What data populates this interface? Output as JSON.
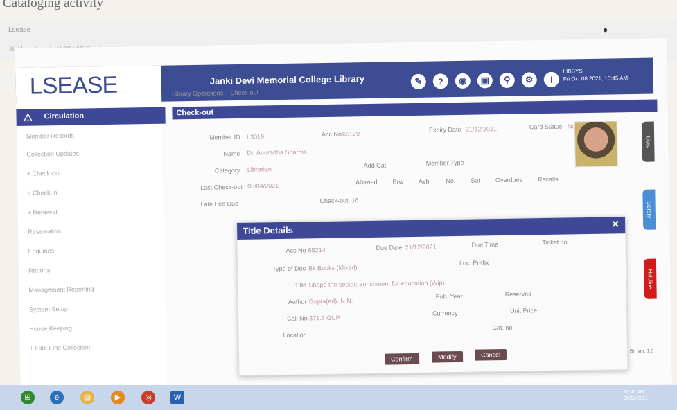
{
  "caption": "Cataloging activity",
  "browser": {
    "tab_label": "Lsease",
    "url": "lib.jdmc.du.ac.in / LSEASE/Circulation/Checkout"
  },
  "app": {
    "logo": "LSEASE",
    "title": "Janki Devi Memorial College Library",
    "user_name": "LIBSYS",
    "user_date": "Fri Oct 08 2021, 10:45 AM",
    "header_icons": [
      "pen-icon",
      "help-icon",
      "camera-icon",
      "image-icon",
      "link-icon",
      "settings-icon",
      "info-icon"
    ]
  },
  "sidebar": {
    "active": "Circulation",
    "items": [
      "Member Records",
      "Collection Updates",
      "+ Check-out",
      "+ Check-in",
      "+ Renewal",
      "Reservation",
      "Enquiries",
      "Reports",
      "Management Reporting",
      "System Setup",
      "House Keeping",
      "+ Late Fine Collection"
    ]
  },
  "crumb": {
    "parent": "Library Operations",
    "current": "Check-out"
  },
  "section_title": "Check-out",
  "member": {
    "member_id_label": "Member ID",
    "member_id": "L3019",
    "acc_no_label": "Acc No",
    "acc_no": "65129",
    "expiry_label": "Expiry Date",
    "expiry": "31/12/2021",
    "card_status_label": "Card Status",
    "card_status": "Normal",
    "name_label": "Name",
    "name": "Dr. Anuradha Sharma",
    "category_label": "Category",
    "category": "Librarian",
    "add_cat_label": "Add Cat.",
    "member_type_label": "Member Type",
    "last_checkout_label": "Last Check-out",
    "last_checkout": "05/04/2021",
    "late_fee_label": "Late Fee Due",
    "checked_out_label": "Check-out",
    "checked_out": "16",
    "col_headers": [
      "Allowed",
      "Brw",
      "Avbl",
      "No.",
      "Sat",
      "Overdues",
      "Recalls"
    ]
  },
  "side_tabs": [
    "Lists",
    "Library",
    "Helpline"
  ],
  "modal": {
    "title": "Title Details",
    "acc_no_label": "Acc No",
    "acc_no": "65214",
    "due_date_label": "Due Date",
    "due_date": "21/12/2021",
    "due_time_label": "Due Time",
    "ticket_label": "Ticket no",
    "type_label": "Type of Doc",
    "type_value": "Bk    Books (Mixed)",
    "loc_label": "Loc. Prefix",
    "title_label": "Title",
    "title_value": "Shape the sector; enrichment for education (Wip)",
    "author_label": "Author",
    "author_value": "Gupta(ed). N.N.",
    "pub_year_label": "Pub. Year",
    "reserves_label": "Reserves",
    "call_no_label": "Call No.",
    "call_no_value": "371.3 GUP",
    "currency_label": "Currency",
    "unit_price_label": "Unit Price",
    "location_label": "Location",
    "cat_no_label": "Cat. no.",
    "buttons": [
      "Confirm",
      "Modify",
      "Cancel"
    ]
  },
  "status_right": "Br. Ver. 1.0",
  "taskbar": {
    "time": "10:45 AM",
    "date": "08/10/2021"
  }
}
